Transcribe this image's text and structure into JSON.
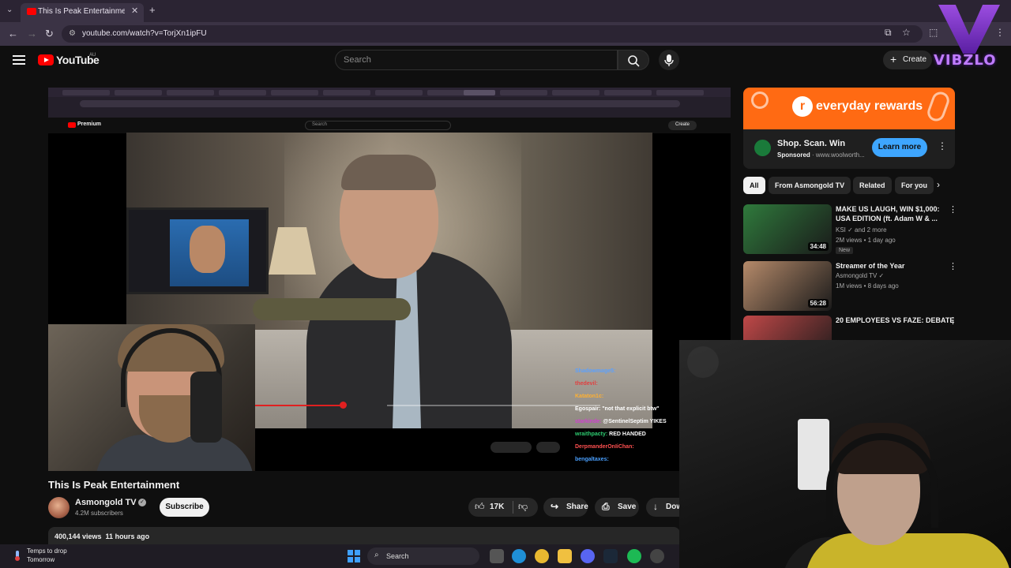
{
  "browser": {
    "tab_title": "This Is Peak Entertainment - YouTube",
    "url": "youtube.com/watch?v=TorjXn1ipFU"
  },
  "youtube": {
    "logo_text": "YouTube",
    "country": "AU",
    "search_placeholder": "Search",
    "create_label": "Create"
  },
  "video": {
    "title": "This Is Peak Entertainment",
    "channel": "Asmongold TV",
    "subscribers": "4.2M subscribers",
    "subscribe_label": "Subscribe",
    "likes": "17K",
    "share_label": "Share",
    "save_label": "Save",
    "download_label": "Dow",
    "views_time": "400,144 views  11 hours ago",
    "progress": 0.26
  },
  "embedded": {
    "premium_label": "Premium",
    "search_label": "Search",
    "create_label": "Create",
    "chat": [
      {
        "user": "Shadowmage5:",
        "msg": "",
        "color": "#5aa0ff"
      },
      {
        "user": "thedevil:",
        "msg": "",
        "color": "#e04040"
      },
      {
        "user": "Kataton1c:",
        "msg": "",
        "color": "#ffb030"
      },
      {
        "user": "Egospair:",
        "msg": "\"not that explicit btw\"",
        "color": "#ffffff"
      },
      {
        "user": "starkinde:",
        "msg": "@SentinelSeptim YIKES",
        "color": "#d040d0"
      },
      {
        "user": "wraithpacty:",
        "msg": "RED HANDED",
        "color": "#2ecc71"
      },
      {
        "user": "DerpmanderOnIiChan:",
        "msg": "",
        "color": "#ff5050"
      },
      {
        "user": "bengaltaxes:",
        "msg": "",
        "color": "#4aa0ff"
      }
    ]
  },
  "ad": {
    "brand": "everyday rewards",
    "headline": "Shop. Scan. Win",
    "sponsored": "Sponsored",
    "domain": "· www.woolworth...",
    "cta": "Learn more"
  },
  "chips": [
    "All",
    "From Asmongold TV",
    "Related",
    "For you"
  ],
  "recommendations": [
    {
      "title": "MAKE US LAUGH, WIN $1,000: USA EDITION (ft. Adam W & ...",
      "channel": "KSI",
      "extra": "and 2 more",
      "meta": "2M views • 1 day ago",
      "badge": "New",
      "duration": "34:48",
      "thumb": "#2f7a3c"
    },
    {
      "title": "Streamer of the Year",
      "channel": "Asmongold TV",
      "extra": "",
      "meta": "1M views • 8 days ago",
      "badge": "",
      "duration": "56:28",
      "thumb": "#b58a6a"
    },
    {
      "title": "20 EMPLOYEES VS FAZE: DEBATE",
      "channel": "",
      "extra": "",
      "meta": "",
      "badge": "",
      "duration": "",
      "thumb": "#c04848"
    }
  ],
  "watermark": "VIBZLO",
  "taskbar": {
    "weather_title": "Temps to drop",
    "weather_sub": "Tomorrow",
    "search_label": "Search"
  },
  "colors": {
    "yt_red": "#ff0000",
    "ad_orange": "#ff6a13",
    "link_blue": "#3ea6ff"
  }
}
